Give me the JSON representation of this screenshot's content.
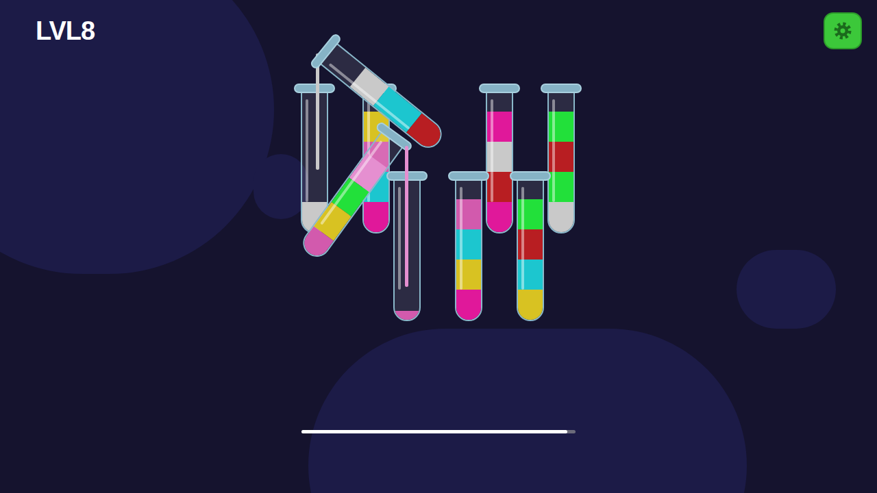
{
  "level_label": "LVL8",
  "progress": {
    "level": 0.97
  },
  "rows": [
    [
      {
        "lifted": false,
        "receiving": true,
        "layers": [
          {
            "color": "#c9c9c9",
            "level": 1
          }
        ]
      },
      {
        "lifted": false,
        "receiving": false,
        "layers": [
          {
            "color": "#e0189a",
            "level": 1
          },
          {
            "color": "#1cc6cf",
            "level": 1
          },
          {
            "color": "#d25aad",
            "level": 1
          },
          {
            "color": "#d8c222",
            "level": 1
          }
        ]
      },
      {
        "lifted": true,
        "receiving": false,
        "layers": [
          {
            "color": "#b81e22",
            "level": 1
          },
          {
            "color": "#1cc6cf",
            "level": 1.4
          },
          {
            "color": "#c9c9c9",
            "level": 1
          }
        ]
      },
      {
        "lifted": false,
        "receiving": false,
        "layers": [
          {
            "color": "#e0189a",
            "level": 1
          },
          {
            "color": "#b81e22",
            "level": 1
          },
          {
            "color": "#c9c9c9",
            "level": 1
          },
          {
            "color": "#e0189a",
            "level": 1
          }
        ]
      },
      {
        "lifted": false,
        "receiving": false,
        "layers": [
          {
            "color": "#c9c9c9",
            "level": 1
          },
          {
            "color": "#22e03a",
            "level": 1
          },
          {
            "color": "#b81e22",
            "level": 1
          },
          {
            "color": "#22e03a",
            "level": 1
          }
        ]
      }
    ],
    [
      {
        "lifted": true,
        "receiving": false,
        "layers": [
          {
            "color": "#d25aad",
            "level": 0.8
          },
          {
            "color": "#d8c222",
            "level": 1
          },
          {
            "color": "#22e03a",
            "level": 1
          },
          {
            "color": "#e58fd0",
            "level": 1
          }
        ]
      },
      {
        "lifted": false,
        "receiving": true,
        "layers": [
          {
            "color": "#d25aad",
            "level": 0.3
          }
        ]
      },
      {
        "lifted": false,
        "receiving": false,
        "layers": [
          {
            "color": "#e0189a",
            "level": 1
          },
          {
            "color": "#d8c222",
            "level": 1
          },
          {
            "color": "#1cc6cf",
            "level": 1
          },
          {
            "color": "#d25aad",
            "level": 1
          }
        ]
      },
      {
        "lifted": false,
        "receiving": false,
        "layers": [
          {
            "color": "#d8c222",
            "level": 1
          },
          {
            "color": "#1cc6cf",
            "level": 1
          },
          {
            "color": "#b81e22",
            "level": 1
          },
          {
            "color": "#22e03a",
            "level": 1
          }
        ]
      }
    ]
  ]
}
